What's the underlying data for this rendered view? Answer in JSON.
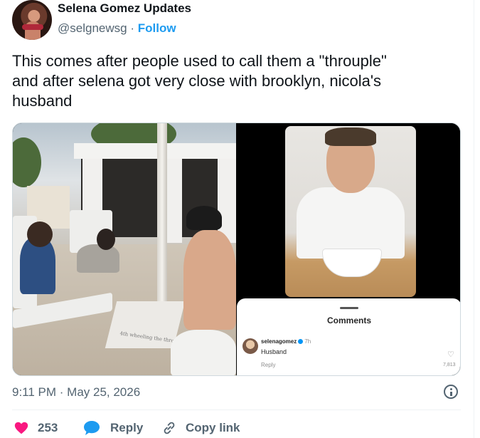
{
  "author": {
    "name": "Selena Gomez Updates",
    "handle": "@selgnewsg",
    "separator": "·",
    "follow_label": "Follow"
  },
  "tweet": {
    "text_line1": "This comes after people used to call them a \"throuple\"",
    "text_line2": "and after selena got very close with brooklyn, nicola's",
    "text_line3": "husband"
  },
  "media": {
    "left_photo_table_text": "4th wheeling the throuple...",
    "comment_panel": {
      "title": "Comments",
      "username": "selenagomez",
      "time": "7h",
      "comment": "Husband",
      "reply_label": "Reply",
      "likes": "7,813"
    }
  },
  "meta": {
    "timestamp": "9:11 PM · May 25, 2026"
  },
  "actions": {
    "like_count": "253",
    "reply_label": "Reply",
    "copy_link_label": "Copy link"
  },
  "colors": {
    "accent": "#1d9bf0",
    "like": "#f91880",
    "muted": "#536471",
    "text": "#0f1419"
  },
  "icons": [
    "info-icon",
    "heart-icon",
    "reply-bubble-icon",
    "link-icon",
    "verified-badge-icon"
  ]
}
